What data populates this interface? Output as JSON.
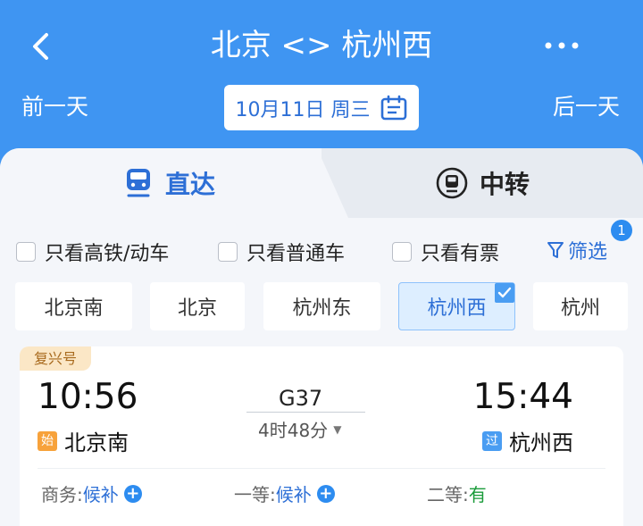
{
  "header": {
    "title": "北京 <> 杭州西",
    "prev_day": "前一天",
    "next_day": "后一天",
    "date": "10月11日 周三"
  },
  "tabs": {
    "direct": "直达",
    "transfer": "中转"
  },
  "filters": {
    "high_speed": "只看高铁/动车",
    "regular": "只看普通车",
    "available": "只看有票",
    "filter_label": "筛选",
    "filter_count": "1"
  },
  "stations": [
    {
      "name": "北京南",
      "selected": false
    },
    {
      "name": "北京",
      "selected": false
    },
    {
      "name": "杭州东",
      "selected": false
    },
    {
      "name": "杭州西",
      "selected": true
    },
    {
      "name": "杭州",
      "selected": false
    }
  ],
  "train": {
    "type": "复兴号",
    "departure_time": "10:56",
    "arrival_time": "15:44",
    "number": "G37",
    "duration": "4时48分",
    "departure_tag": "始",
    "departure_station": "北京南",
    "arrival_tag": "过",
    "arrival_station": "杭州西",
    "seats": [
      {
        "label": "商务:",
        "status": "候补"
      },
      {
        "label": "一等:",
        "status": "候补"
      },
      {
        "label": "二等:",
        "status": "有"
      }
    ]
  },
  "colors": {
    "header_bg": "#3f95f2",
    "accent_blue": "#2d6fd6",
    "available_green": "#1a9b3a",
    "train_type_bg": "#fbe7c6"
  }
}
